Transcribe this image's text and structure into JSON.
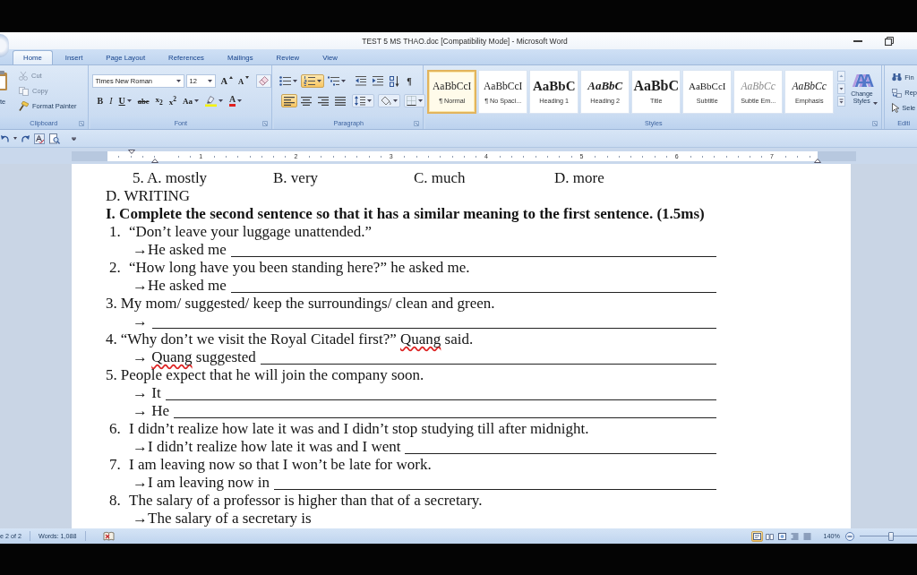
{
  "window": {
    "title": "TEST 5 MS THAO.doc [Compatibility Mode] - Microsoft Word"
  },
  "tabs": [
    {
      "label": "Home",
      "selected": true
    },
    {
      "label": "Insert",
      "selected": false
    },
    {
      "label": "Page Layout",
      "selected": false
    },
    {
      "label": "References",
      "selected": false
    },
    {
      "label": "Mailings",
      "selected": false
    },
    {
      "label": "Review",
      "selected": false
    },
    {
      "label": "View",
      "selected": false
    }
  ],
  "ribbon": {
    "clipboard": {
      "paste": "te",
      "items": [
        {
          "kind": "cut",
          "label": "Cut",
          "disabled": true
        },
        {
          "kind": "copy",
          "label": "Copy",
          "disabled": true
        },
        {
          "kind": "format_painter",
          "label": "Format Painter",
          "disabled": false
        }
      ],
      "label": "Clipboard"
    },
    "font": {
      "name": "Times New Roman",
      "size": "12",
      "grow": "A",
      "shrink": "A",
      "formats": [
        {
          "kind": "bold",
          "text": "B",
          "dropdown": false
        },
        {
          "kind": "italic",
          "text": "I",
          "dropdown": false
        },
        {
          "kind": "underline",
          "text": "U",
          "dropdown": true
        },
        {
          "kind": "strikethrough",
          "text": "abc",
          "dropdown": false
        },
        {
          "kind": "subscript",
          "text": "x$_{2}$",
          "dropdown": false
        },
        {
          "kind": "superscript",
          "text": "x$^{2}$",
          "dropdown": false
        },
        {
          "kind": "change_case",
          "text": "Aa",
          "dropdown": true
        }
      ],
      "font_color": "A",
      "label": "Font"
    },
    "paragraph": {
      "rows": [
        [
          {
            "kind": "bullets",
            "selected": false,
            "dropdown": true
          },
          {
            "kind": "numbering",
            "selected": true,
            "dropdown": true
          },
          {
            "kind": "multilevel",
            "selected": false,
            "dropdown": true
          },
          {
            "kind": "decrease_indent",
            "selected": false,
            "dropdown": false
          },
          {
            "kind": "increase_indent",
            "selected": false,
            "dropdown": false
          },
          {
            "kind": "sort",
            "selected": false,
            "dropdown": false
          },
          {
            "kind": "show_marks",
            "text": "¶",
            "selected": false,
            "dropdown": false
          }
        ],
        [
          {
            "kind": "align_left",
            "selected": true,
            "dropdown": false
          },
          {
            "kind": "center",
            "selected": false,
            "dropdown": false
          },
          {
            "kind": "align_right",
            "selected": false,
            "dropdown": false
          },
          {
            "kind": "justify",
            "selected": false,
            "dropdown": false
          },
          {
            "kind": "line_spacing",
            "selected": false,
            "dropdown": true
          },
          {
            "kind": "shading",
            "selected": false,
            "dropdown": true
          },
          {
            "kind": "borders",
            "selected": false,
            "dropdown": true
          }
        ]
      ],
      "label": "Paragraph"
    },
    "styles": {
      "tiles": [
        {
          "kind": "normal",
          "preview": "AaBbCcI",
          "name": "¶ Normal",
          "selected": true
        },
        {
          "kind": "no_spacing",
          "preview": "AaBbCcI",
          "name": "¶ No Spaci...",
          "selected": false
        },
        {
          "kind": "heading1",
          "preview": "AaBbC",
          "name": "Heading 1",
          "selected": false
        },
        {
          "kind": "heading2",
          "preview": "AaBbC",
          "name": "Heading 2",
          "selected": false
        },
        {
          "kind": "title",
          "preview": "AaBbC",
          "name": "Title",
          "selected": false
        },
        {
          "kind": "subtitle",
          "preview": "AaBbCcI",
          "name": "Subtitle",
          "selected": false
        },
        {
          "kind": "subtle_emphasis",
          "preview": "AaBbCc",
          "name": "Subtle Em...",
          "selected": false
        },
        {
          "kind": "emphasis",
          "preview": "AaBbCc",
          "name": "Emphasis",
          "selected": false
        }
      ],
      "change_styles": {
        "glyph": "AA",
        "label": "Change Styles"
      },
      "label": "Styles"
    },
    "editing": {
      "items": [
        {
          "kind": "find",
          "label": "Fin"
        },
        {
          "kind": "replace",
          "label": "Rep"
        },
        {
          "kind": "select",
          "label": "Sele"
        }
      ],
      "label": "Editi"
    }
  },
  "ruler": {
    "numbers": [
      "1",
      "2",
      "3",
      "4",
      "5",
      "6",
      "7"
    ]
  },
  "document": {
    "options": [
      "5. A. mostly",
      "B. very",
      "C. much",
      "D. more"
    ],
    "section": "D. WRITING",
    "instruction": "I. Complete the second sentence so that it has a similar meaning to the first sentence. (1.5ms)",
    "items": [
      {
        "number": "1.",
        "kind": "hanging",
        "prompt": [
          {
            "text": "“Don’t leave your luggage unattended.”",
            "misspelled": false
          }
        ],
        "answers": [
          {
            "parts": [
              {
                "text": "→He asked me",
                "misspelled": false
              }
            ],
            "blank": true
          }
        ]
      },
      {
        "number": "2.",
        "kind": "hanging",
        "prompt": [
          {
            "text": "“How long have you been standing here?” he asked me.",
            "misspelled": false
          }
        ],
        "answers": [
          {
            "parts": [
              {
                "text": "→He asked me",
                "misspelled": false
              }
            ],
            "blank": true
          }
        ]
      },
      {
        "number": "3.",
        "kind": "inline",
        "prompt": [
          {
            "text": "My mom/ suggested/ keep the surroundings/ clean and green.",
            "misspelled": false
          }
        ],
        "answers": [
          {
            "parts": [
              {
                "text": "→",
                "misspelled": false
              }
            ],
            "blank": true
          }
        ]
      },
      {
        "number": "4.",
        "kind": "inline",
        "prompt": [
          {
            "text": "“Why don’t we visit the Royal Citadel first?” ",
            "misspelled": false
          },
          {
            "text": "Quang",
            "misspelled": true
          },
          {
            "text": " said.",
            "misspelled": false
          }
        ],
        "answers": [
          {
            "parts": [
              {
                "text": "→ ",
                "misspelled": false
              },
              {
                "text": "Quang",
                "misspelled": true
              },
              {
                "text": " suggested",
                "misspelled": false
              }
            ],
            "blank": true
          }
        ]
      },
      {
        "number": "5.",
        "kind": "inline",
        "prompt": [
          {
            "text": "People expect that he will join the company soon.",
            "misspelled": false
          }
        ],
        "answers": [
          {
            "parts": [
              {
                "text": "→ It",
                "misspelled": false
              }
            ],
            "blank": true
          },
          {
            "parts": [
              {
                "text": "→ He",
                "misspelled": false
              }
            ],
            "blank": true
          }
        ]
      },
      {
        "number": "6.",
        "kind": "hanging",
        "prompt": [
          {
            "text": "I didn’t realize how late it was and I didn’t stop studying till after midnight.",
            "misspelled": false
          }
        ],
        "answers": [
          {
            "parts": [
              {
                "text": "→I didn’t realize how late it was and I went",
                "misspelled": false
              }
            ],
            "blank": true
          }
        ]
      },
      {
        "number": "7.",
        "kind": "hanging",
        "prompt": [
          {
            "text": "I am leaving now so that I won’t be late for work.",
            "misspelled": false
          }
        ],
        "answers": [
          {
            "parts": [
              {
                "text": "→I am leaving now in",
                "misspelled": false
              }
            ],
            "blank": true
          }
        ]
      },
      {
        "number": "8.",
        "kind": "hanging",
        "prompt": [
          {
            "text": "The salary of a professor is higher than that of a secretary.",
            "misspelled": false
          }
        ],
        "answers": [
          {
            "parts": [
              {
                "text": "→The salary of a secretary is",
                "misspelled": false
              }
            ],
            "blank": false
          }
        ]
      }
    ]
  },
  "status_bar": {
    "page": "e 2 of 2",
    "words": "Words: 1,088",
    "views": [
      {
        "kind": "print_layout",
        "selected": true
      },
      {
        "kind": "full_screen",
        "selected": false
      },
      {
        "kind": "web_layout",
        "selected": false
      },
      {
        "kind": "outline",
        "selected": false
      },
      {
        "kind": "draft",
        "selected": false
      }
    ],
    "zoom": "140%",
    "zoom_slider": {
      "level": 0.55
    }
  }
}
